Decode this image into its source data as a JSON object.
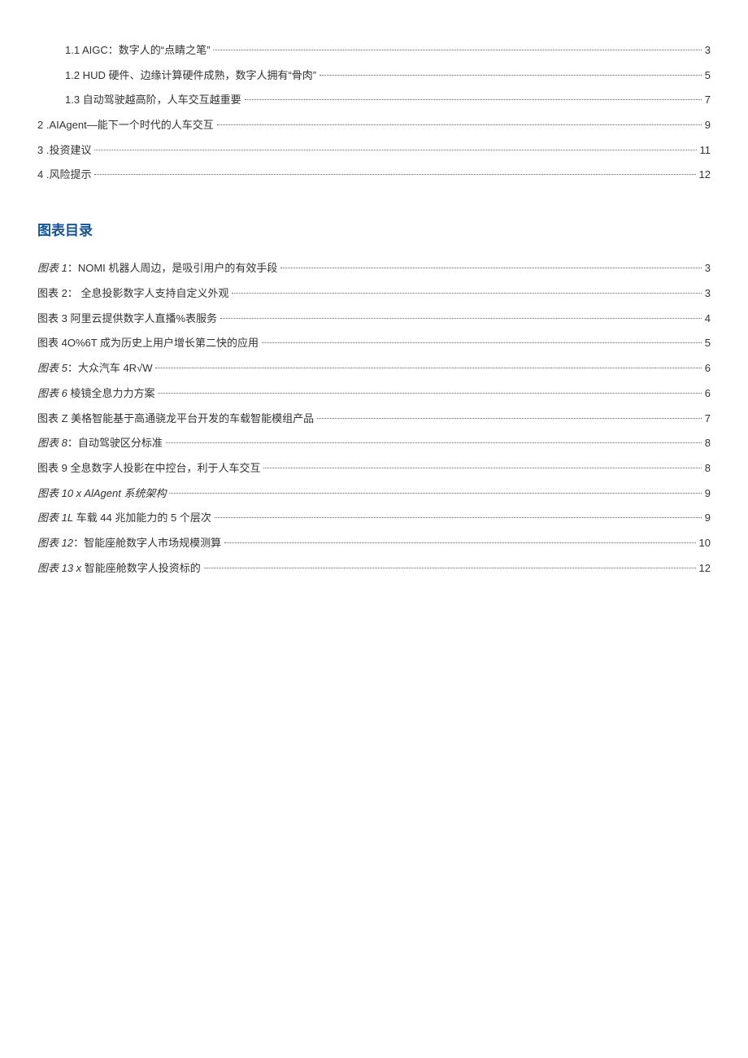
{
  "toc_top": [
    {
      "indent": 1,
      "text": "1.1  AIGC：数字人的“点睛之笔”",
      "page": "3"
    },
    {
      "indent": 1,
      "text": "1.2  HUD 硬件、边缘计算硬件成熟，数字人拥有“骨肉”",
      "page": "5"
    },
    {
      "indent": 1,
      "text": "1.3  自动驾驶越高阶，人车交互越重要",
      "page": "7"
    },
    {
      "indent": 0,
      "text": "2   .AIAgent—能下一个时代的人车交互",
      "page": "9"
    },
    {
      "indent": 0,
      "text": "3   .投资建议",
      "page": "11"
    },
    {
      "indent": 0,
      "text": "4   .风险提示",
      "page": "12"
    }
  ],
  "figures_heading": "图表目录",
  "figures": [
    {
      "prefix": "图表 1",
      "italicPrefix": true,
      "text": "：NOMI 机器人周边，是吸引用户的有效手段",
      "page": "3"
    },
    {
      "prefix": "图表 2",
      "italicPrefix": false,
      "text": "： 全息投影数字人支持自定义外观",
      "page": "3"
    },
    {
      "prefix": "图表 3",
      "italicPrefix": false,
      "text": " 阿里云提供数字人直播%表服务",
      "page": "4"
    },
    {
      "prefix": "图表 4O%6T",
      "italicPrefix": false,
      "text": " 成为历史上用户增长第二快的应用",
      "page": "5"
    },
    {
      "prefix": "图表 5",
      "italicPrefix": true,
      "text": "：大众汽车 4R√W",
      "page": "6"
    },
    {
      "prefix": "图表 6",
      "italicPrefix": true,
      "text": " 棱镜全息力力方案",
      "page": "6"
    },
    {
      "prefix": "图表 Z",
      "italicPrefix": false,
      "text": " 美格智能基于高通骁龙平台开发的车载智能模组产品",
      "page": "7"
    },
    {
      "prefix": "图表 8",
      "italicPrefix": true,
      "text": "：自动驾驶区分标准",
      "page": "8"
    },
    {
      "prefix": "图表 9",
      "italicPrefix": false,
      "text": " 全息数字人投影在中控台，利于人车交互",
      "page": "8"
    },
    {
      "prefix": "图表 10 x AlAgent 系统架构",
      "italicPrefix": true,
      "text": "",
      "page": "9"
    },
    {
      "prefix": "图表 1L",
      "italicPrefix": true,
      "text": " 车载 44 兆加能力的 5 个层次",
      "page": "9"
    },
    {
      "prefix": "图表 12",
      "italicPrefix": true,
      "text": "：智能座舱数字人市场规模测算",
      "page": "10"
    },
    {
      "prefix": "图表 13 x",
      "italicPrefix": true,
      "text": " 智能座舱数字人投资标的",
      "page": "12"
    }
  ]
}
